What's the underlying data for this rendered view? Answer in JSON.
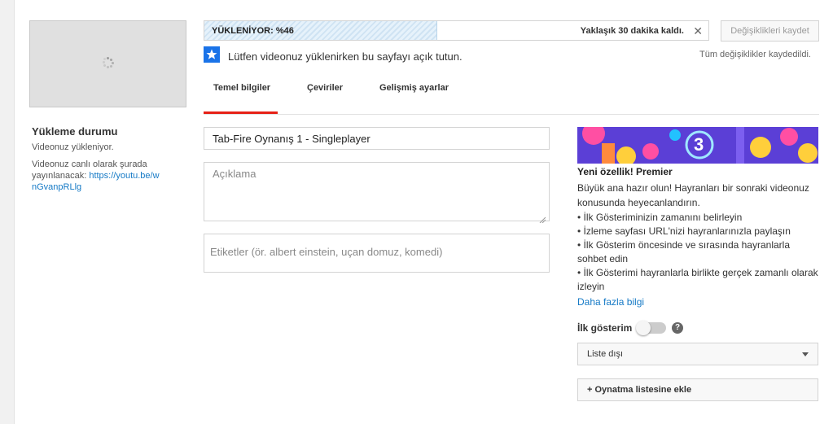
{
  "sidebar": {
    "status_title": "Yükleme durumu",
    "status_text": "Videonuz yükleniyor.",
    "link_prefix": "Videonuz canlı olarak şurada yayınlanacak:",
    "link_text": "https://youtu.be/wnGvanpRLlg"
  },
  "upload": {
    "label": "YÜKLENİYOR: %46",
    "progress_percent": 46,
    "remaining": "Yaklaşık 30 dakika kaldı.",
    "close_icon": "close-icon",
    "save_button": "Değişiklikleri kaydet",
    "saved_note": "Tüm değişiklikler kaydedildi.",
    "keep_open": "Lütfen videonuz yüklenirken bu sayfayı açık tutun."
  },
  "tabs": [
    {
      "label": "Temel bilgiler",
      "active": true
    },
    {
      "label": "Çeviriler",
      "active": false
    },
    {
      "label": "Gelişmiş ayarlar",
      "active": false
    }
  ],
  "form": {
    "title_value": "Tab-Fire Oynanış 1 - Singleplayer",
    "description_placeholder": "Açıklama",
    "tags_placeholder": "Etiketler (ör. albert einstein, uçan domuz, komedi)"
  },
  "premiere": {
    "banner_number": "3",
    "title": "Yeni özellik! Premier",
    "description": "Büyük ana hazır olun! Hayranları bir sonraki videonuz konusunda heyecanlandırın.",
    "bullets": [
      "• İlk Gösteriminizin zamanını belirleyin",
      "• İzleme sayfası URL'nizi hayranlarınızla paylaşın",
      "• İlk Gösterim öncesinde ve sırasında hayranlarla sohbet edin",
      "• İlk Gösterimi hayranlarla birlikte gerçek zamanlı olarak izleyin"
    ],
    "learn_more": "Daha fazla bilgi",
    "first_label": "İlk gösterim",
    "first_toggle_on": false,
    "help_icon": "?"
  },
  "visibility": {
    "selected": "Liste dışı"
  },
  "playlist_button": "+ Oynatma listesine ekle",
  "colors": {
    "accent_red": "#e62117",
    "link_blue": "#167ac6",
    "star_blue": "#1a73e8"
  }
}
